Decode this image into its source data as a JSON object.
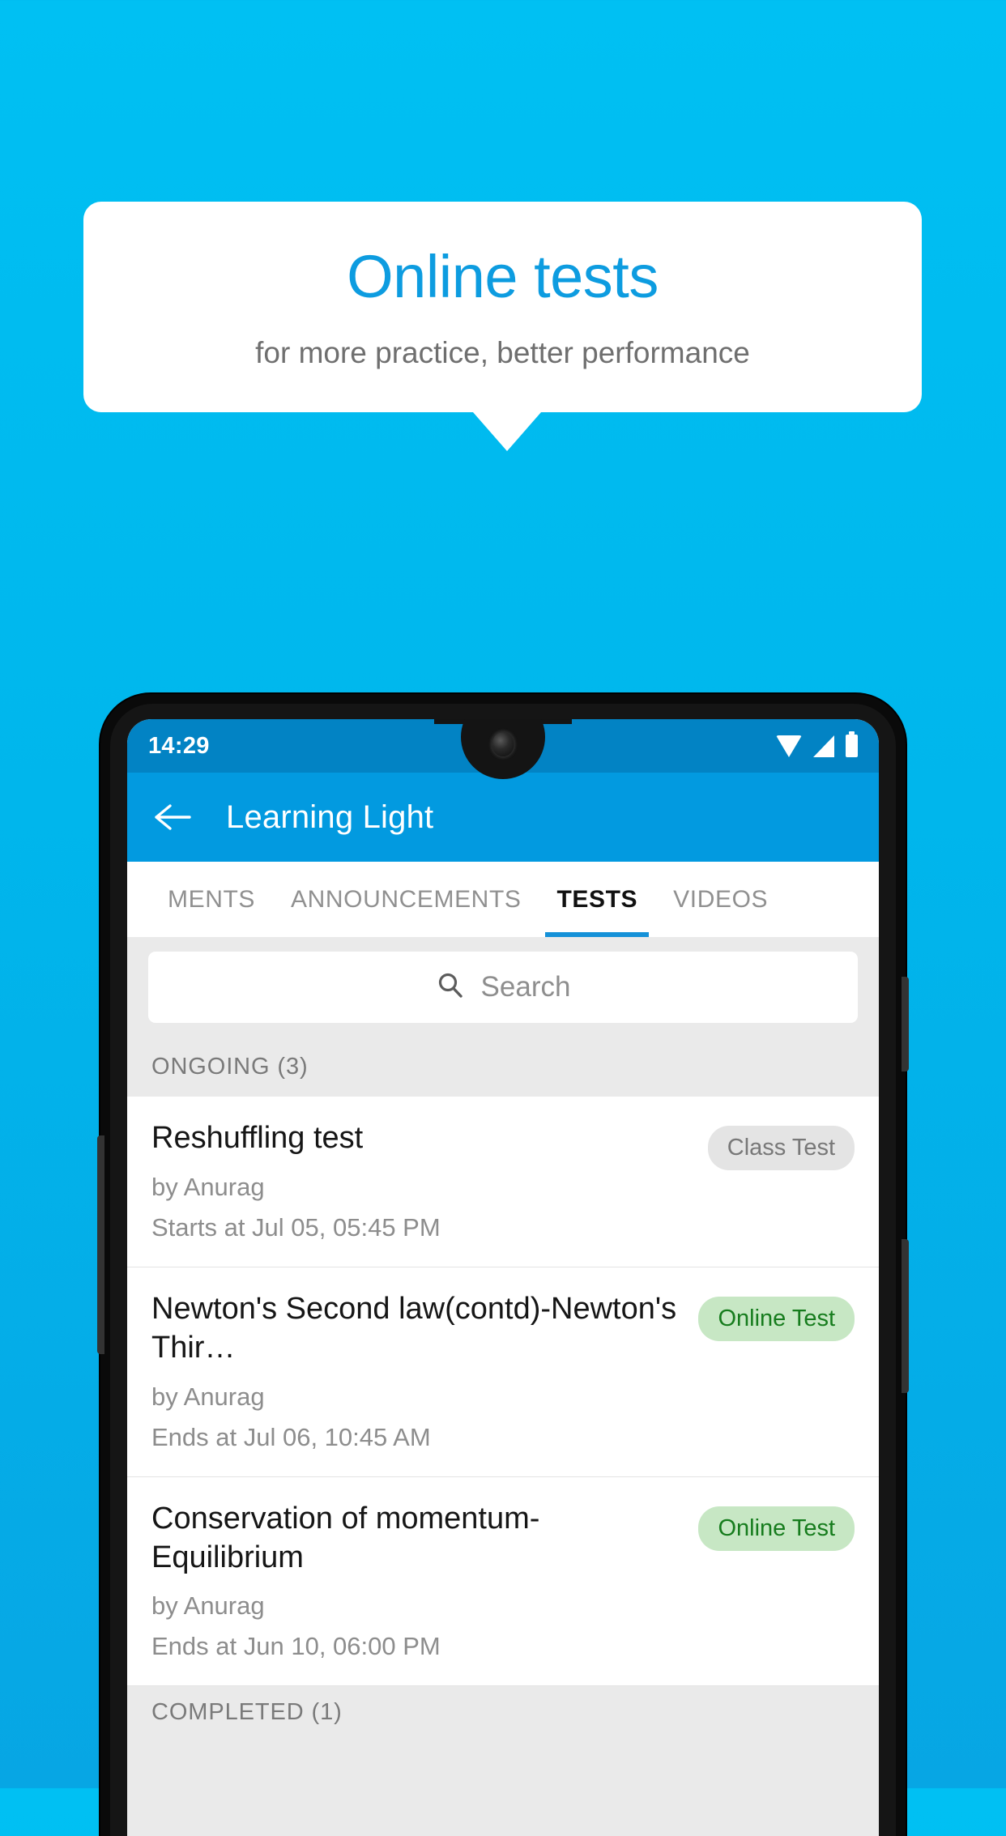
{
  "promo": {
    "title": "Online tests",
    "subtitle": "for more practice, better performance"
  },
  "phone": {
    "statusbar": {
      "time": "14:29",
      "icons": [
        "wifi-icon",
        "signal-icon",
        "battery-icon"
      ]
    },
    "appbar": {
      "back_icon": "back-arrow-icon",
      "title": "Learning Light"
    },
    "tabs": [
      {
        "label": "MENTS",
        "active": false
      },
      {
        "label": "ANNOUNCEMENTS",
        "active": false
      },
      {
        "label": "TESTS",
        "active": true
      },
      {
        "label": "VIDEOS",
        "active": false
      }
    ],
    "search": {
      "icon": "search-icon",
      "placeholder": "Search",
      "value": ""
    },
    "sections": [
      {
        "header": "ONGOING (3)",
        "items": [
          {
            "title": "Reshuffling test",
            "author": "by Anurag",
            "schedule": "Starts at  Jul 05, 05:45 PM",
            "badge": "Class Test",
            "badge_style": "gray"
          },
          {
            "title": "Newton's Second law(contd)-Newton's Thir…",
            "author": "by Anurag",
            "schedule": "Ends at  Jul 06, 10:45 AM",
            "badge": "Online Test",
            "badge_style": "green"
          },
          {
            "title": "Conservation of momentum-Equilibrium",
            "author": "by Anurag",
            "schedule": "Ends at  Jun 10, 06:00 PM",
            "badge": "Online Test",
            "badge_style": "green"
          }
        ]
      },
      {
        "header": "COMPLETED (1)",
        "items": []
      }
    ]
  },
  "colors": {
    "background_top": "#00c0f3",
    "background_bottom": "#07a6e4",
    "promo_title": "#0d9ce0",
    "appbar": "#029ae0",
    "statusbar": "#0283c4",
    "tab_indicator": "#1591d8",
    "badge_green_bg": "#c7e7c4",
    "badge_green_text": "#167c1d",
    "badge_gray_bg": "#e4e4e4",
    "badge_gray_text": "#787878"
  }
}
